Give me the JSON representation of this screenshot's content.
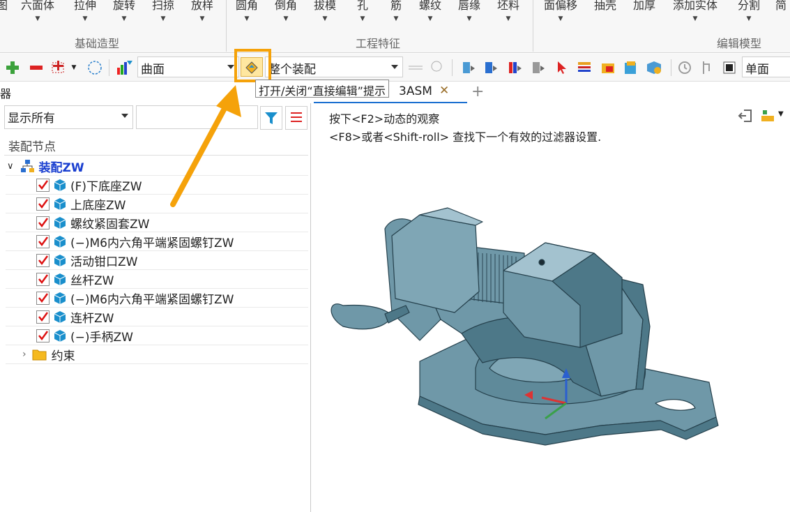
{
  "ribbon": {
    "buttons": [
      "图",
      "六面体",
      "拉伸",
      "旋转",
      "扫掠",
      "放样",
      "圆角",
      "倒角",
      "拔模",
      "孔",
      "筋",
      "螺纹",
      "唇缘",
      "坯料",
      "面偏移",
      "抽壳",
      "加厚",
      "添加实体",
      "分割",
      "简"
    ],
    "groups": {
      "basic": "基础造型",
      "engineering": "工程特征",
      "edit": "编辑模型"
    }
  },
  "toolbar": {
    "filter_combo": "曲面",
    "scope_combo": "整个装配",
    "mode_combo": "单面"
  },
  "tooltip": "打开/关闭“直接编辑”提示",
  "left_edge_label": "器",
  "tab": {
    "label": "3ASM",
    "close": "✕",
    "add": "+"
  },
  "panel": {
    "show_combo": "显示所有",
    "search_value": "",
    "header": "装配节点",
    "root": "装配ZW",
    "items": [
      "(F)下底座ZW",
      "上底座ZW",
      "螺纹紧固套ZW",
      "(−)M6内六角平端紧固螺钉ZW",
      "活动钳口ZW",
      "丝杆ZW",
      "(−)M6内六角平端紧固螺钉ZW",
      "连杆ZW",
      "(−)手柄ZW"
    ],
    "constraints": "约束"
  },
  "viewport": {
    "hint1": "按下<F2>动态的观察",
    "hint2": "<F8>或者<Shift-roll> 查找下一个有效的过滤器设置."
  },
  "colors": {
    "accent": "#f5a20a",
    "model": "#6f98a8",
    "part_icon": "#1a8fcc"
  }
}
